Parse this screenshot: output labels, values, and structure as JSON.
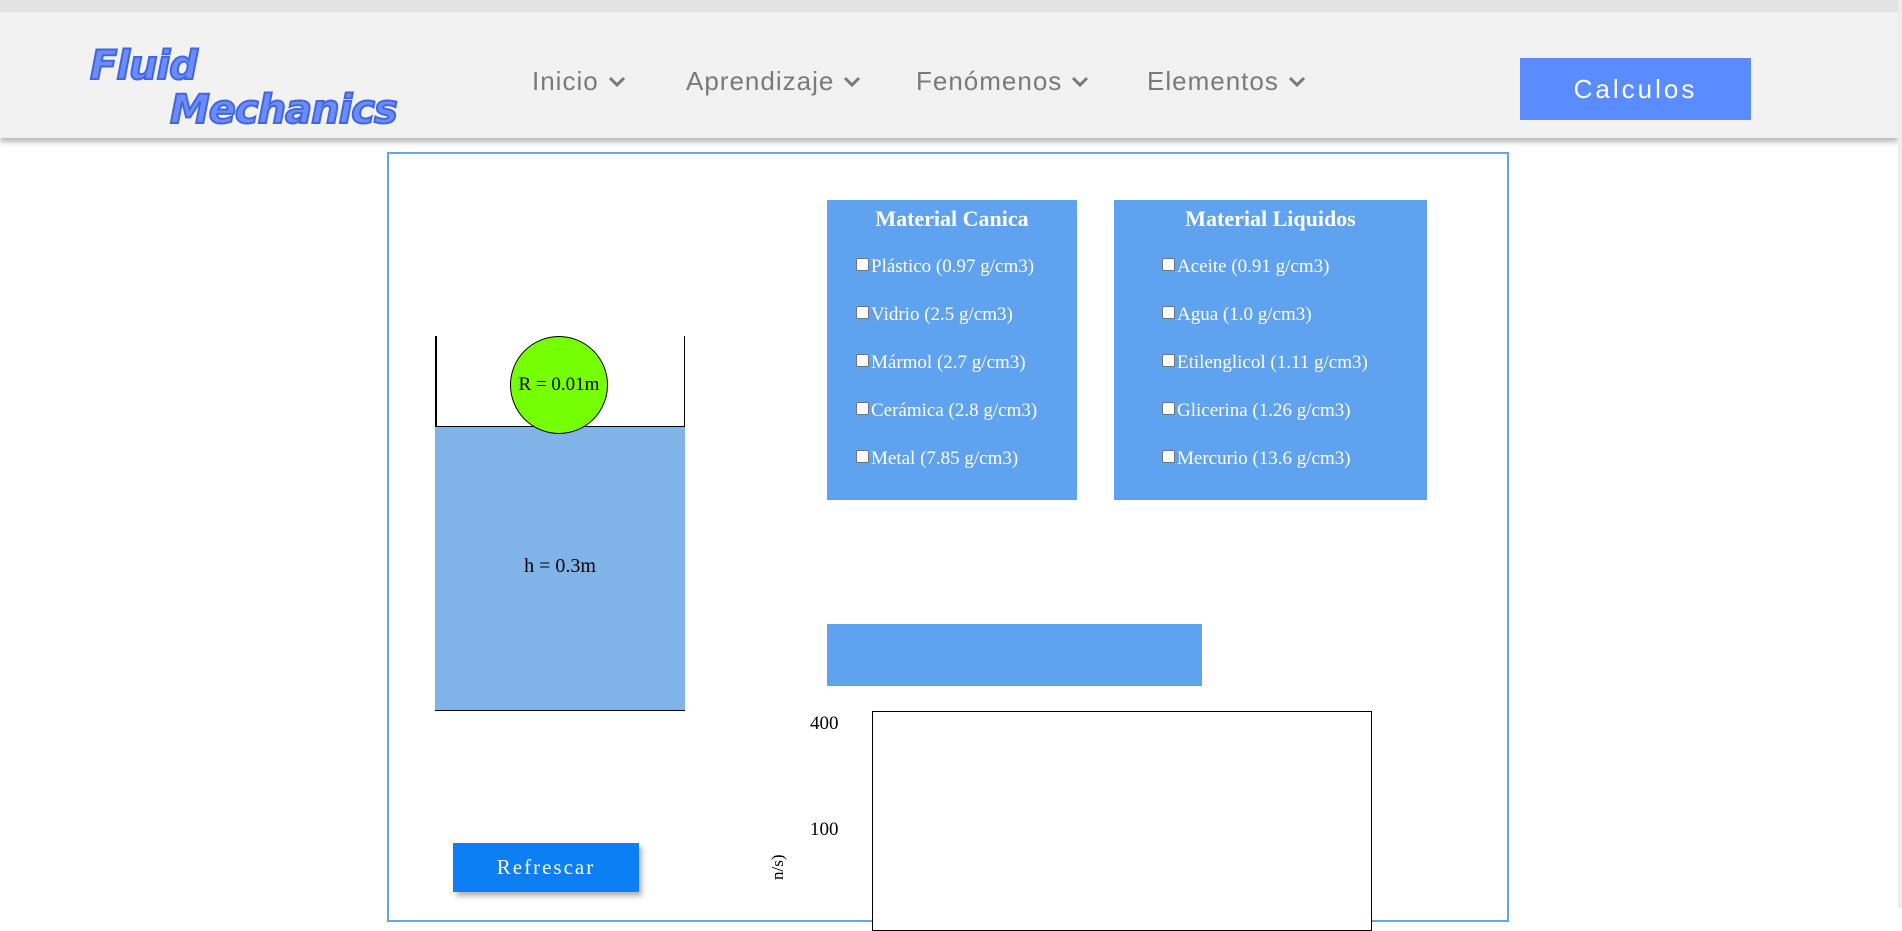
{
  "header": {
    "logo_line1": "Fluid",
    "logo_line2": "Mechanics",
    "nav": [
      {
        "label": "Inicio"
      },
      {
        "label": "Aprendizaje"
      },
      {
        "label": "Fenómenos"
      },
      {
        "label": "Elementos"
      }
    ],
    "cta_label": "Calculos"
  },
  "simulation": {
    "ball_label": "R = 0.01m",
    "liquid_label": "h = 0.3m",
    "refresh_label": "Refrescar"
  },
  "marble_materials": {
    "title": "Material Canica",
    "options": [
      {
        "label": "Plástico (0.97 g/cm3)",
        "checked": false
      },
      {
        "label": "Vidrio (2.5 g/cm3)",
        "checked": false
      },
      {
        "label": "Mármol (2.7 g/cm3)",
        "checked": false
      },
      {
        "label": "Cerámica (2.8 g/cm3)",
        "checked": false
      },
      {
        "label": "Metal (7.85 g/cm3)",
        "checked": false
      }
    ]
  },
  "liquid_materials": {
    "title": "Material Liquidos",
    "options": [
      {
        "label": "Aceite (0.91 g/cm3)",
        "checked": false
      },
      {
        "label": "Agua (1.0 g/cm3)",
        "checked": false
      },
      {
        "label": "Etilenglicol (1.11 g/cm3)",
        "checked": false
      },
      {
        "label": "Glicerina (1.26 g/cm3)",
        "checked": false
      },
      {
        "label": "Mercurio (13.6 g/cm3)",
        "checked": false
      }
    ]
  },
  "chart": {
    "y_ticks": [
      "400",
      "100"
    ],
    "y_label_fragment": "n/s)"
  },
  "colors": {
    "accent": "#5b8cff",
    "panel_blue": "#5fa2ef",
    "liquid": "#80b4e8",
    "ball": "#76ff03",
    "button": "#0d7ff5"
  }
}
